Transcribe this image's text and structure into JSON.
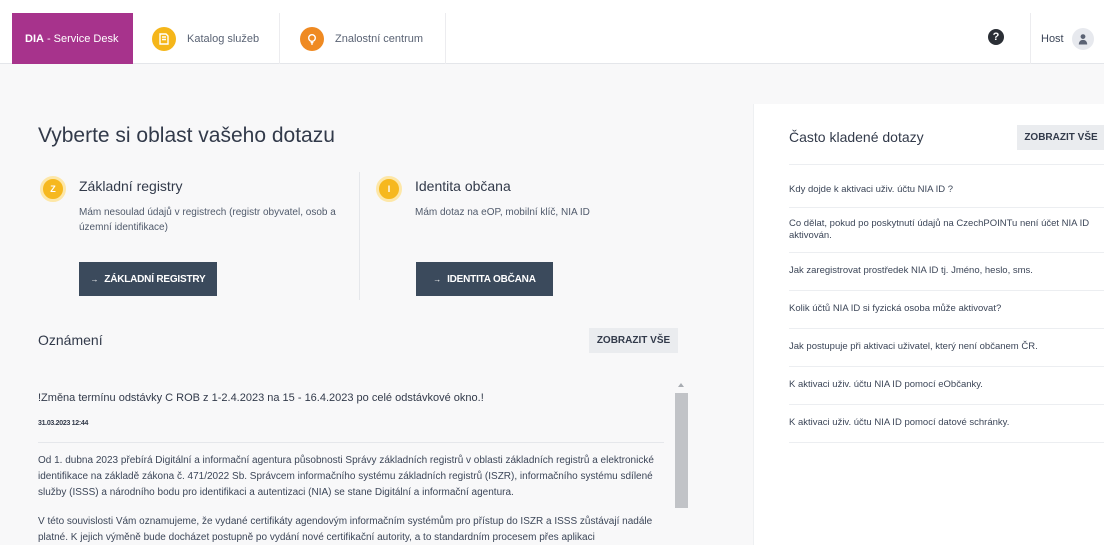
{
  "header": {
    "brand_bold": "DIA",
    "brand_rest": "- Service Desk",
    "tabs": [
      {
        "label": "Katalog služeb",
        "icon": "catalog-icon",
        "color": "#f5b61a"
      },
      {
        "label": "Znalostní centrum",
        "icon": "lightbulb-icon",
        "color": "#ef8a22"
      }
    ],
    "help_label": "?",
    "user_name": "Host",
    "brand_color": "#a7338c"
  },
  "main": {
    "title": "Vyberte si oblast vašeho dotazu",
    "categories": [
      {
        "icon_letter": "Z",
        "title": "Základní registry",
        "description": "Mám nesoulad údajů v registrech (registr obyvatel, osob a územní identifikace)",
        "button_arrow": "→",
        "button": "ZÁKLADNÍ REGISTRY"
      },
      {
        "icon_letter": "I",
        "title": "Identita občana",
        "description": "Mám dotaz na eOP, mobilní klíč, NIA ID",
        "button_arrow": "→",
        "button": "IDENTITA OBČANA"
      }
    ],
    "announcements": {
      "title": "Oznámení",
      "show_all": "ZOBRAZIT VŠE",
      "headline": "!Změna termínu odstávky C ROB z 1-2.4.2023 na 15 - 16.4.2023 po celé odstávkové okno.!",
      "date": "31.03.2023 12:44",
      "paragraphs": [
        "Od 1. dubna 2023 přebírá Digitální a informační agentura působnosti Správy základních registrů v oblasti základních registrů a elektronické identifikace na základě zákona č. 471/2022 Sb. Správcem informačního systému základních registrů (ISZR), informačního systému sdílené služby (ISSS) a národního bodu pro identifikaci a autentizaci (NIA) se stane Digitální a informační agentura.",
        "V této souvislosti Vám oznamujeme, že vydané certifikáty agendovým informačním systémům pro přístup do ISZR a ISSS zůstávají nadále platné. K jejich výměně bude docházet postupně po vydání nové certifikační autority, a to standardním procesem přes aplikaci"
      ]
    }
  },
  "faq": {
    "title": "Často kladené dotazy",
    "show_all": "ZOBRAZIT VŠE",
    "items": [
      "Kdy dojde k aktivaci uživ. účtu NIA ID ?",
      "Co dělat, pokud po poskytnutí údajů na CzechPOINTu není účet NIA ID aktivován.",
      "Jak zaregistrovat prostředek NIA ID tj. Jméno, heslo, sms.",
      "Kolik účtů NIA ID si fyzická osoba může aktivovat?",
      "Jak postupuje při aktivaci uživatel, který není občanem ČR.",
      "K aktivaci uživ. účtu NIA ID pomocí eObčanky.",
      "K aktivaci uživ. účtu NIA ID pomocí datové schránky."
    ]
  }
}
